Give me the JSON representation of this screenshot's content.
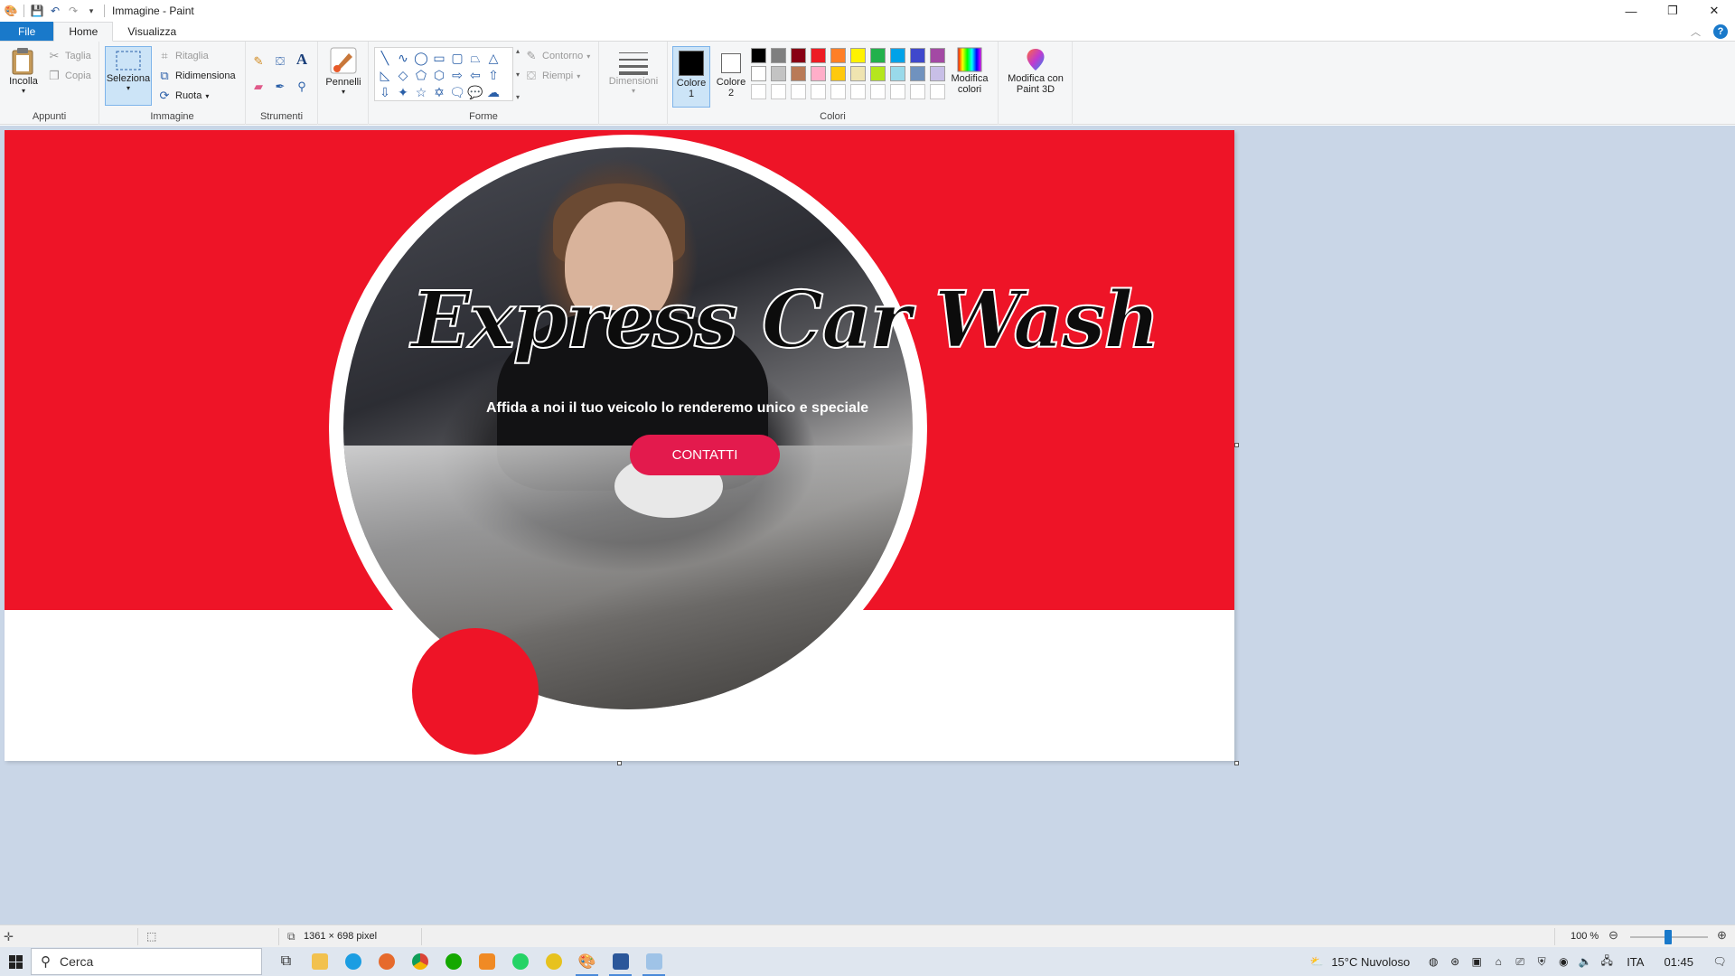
{
  "window": {
    "title": "Immagine - Paint"
  },
  "tabs": {
    "file": "File",
    "home": "Home",
    "view": "Visualizza"
  },
  "ribbon": {
    "clipboard": {
      "label": "Appunti",
      "paste": "Incolla",
      "cut": "Taglia",
      "copy": "Copia"
    },
    "image": {
      "label": "Immagine",
      "select": "Seleziona",
      "crop": "Ritaglia",
      "resize": "Ridimensiona",
      "rotate": "Ruota"
    },
    "tools": {
      "label": "Strumenti"
    },
    "brushes": {
      "label": "Pennelli"
    },
    "shapes": {
      "label": "Forme",
      "outline": "Contorno",
      "fill": "Riempi"
    },
    "size": {
      "label": "Dimensioni"
    },
    "colors": {
      "label": "Colori",
      "color1": "Colore 1",
      "color2": "Colore 2",
      "edit_colors": "Modifica colori",
      "edit_3d": "Modifica con Paint 3D",
      "primary": "#000000",
      "secondary": "#ffffff",
      "row1": [
        "#000000",
        "#7f7f7f",
        "#880015",
        "#ed1c24",
        "#ff7f27",
        "#fff200",
        "#22b14c",
        "#00a2e8",
        "#3f48cc",
        "#a349a4"
      ],
      "row2": [
        "#ffffff",
        "#c3c3c3",
        "#b97a57",
        "#ffaec9",
        "#ffc90e",
        "#efe4b0",
        "#b5e61d",
        "#99d9ea",
        "#7092be",
        "#c8bfe7"
      ],
      "row3": [
        "#ffffff",
        "#ffffff",
        "#ffffff",
        "#ffffff",
        "#ffffff",
        "#ffffff",
        "#ffffff",
        "#ffffff",
        "#ffffff",
        "#ffffff"
      ]
    }
  },
  "canvas_image": {
    "title": "Express Car Wash",
    "subtitle": "Affida a noi il tuo veicolo lo renderemo unico e speciale",
    "button": "CONTATTI",
    "red": "#ee1427",
    "button_color": "#e31a4d"
  },
  "status": {
    "dimensions": "1361 × 698 pixel",
    "zoom": "100 %"
  },
  "taskbar": {
    "search": "Cerca",
    "weather": "15°C  Nuvoloso",
    "lang": "ITA",
    "time": "01:45"
  }
}
